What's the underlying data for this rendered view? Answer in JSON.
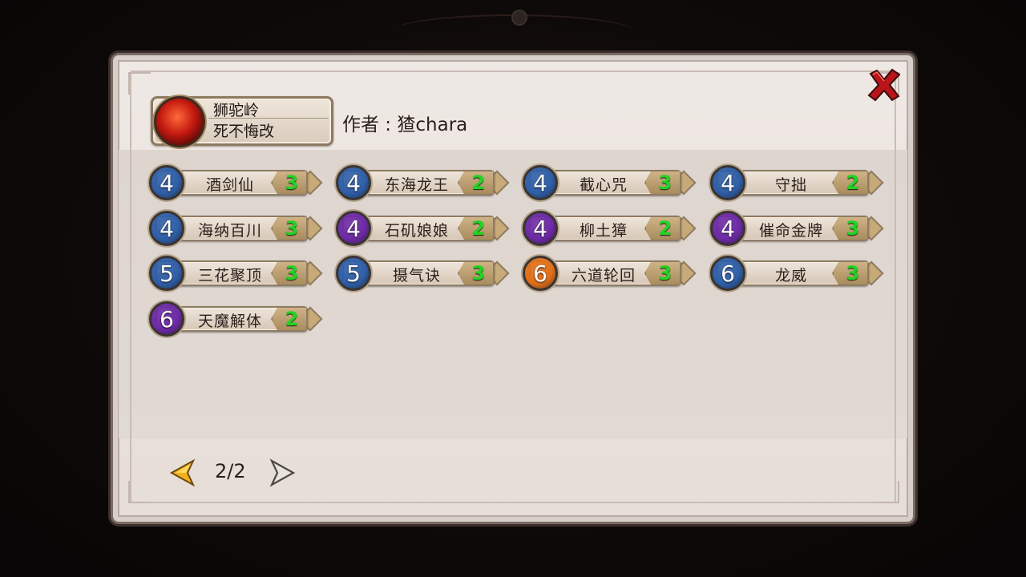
{
  "header": {
    "badge_line1": "狮驼岭",
    "badge_line2": "死不悔改",
    "author": "作者 : 猹chara"
  },
  "colors": {
    "blue": "#2f5fa8",
    "purple": "#6d2aa6",
    "orange": "#e0701a",
    "cost_green": "#22d322"
  },
  "skills": [
    {
      "level": "4",
      "name": "酒剑仙",
      "cost": "3",
      "color": "blue"
    },
    {
      "level": "4",
      "name": "东海龙王",
      "cost": "2",
      "color": "blue"
    },
    {
      "level": "4",
      "name": "截心咒",
      "cost": "3",
      "color": "blue"
    },
    {
      "level": "4",
      "name": "守拙",
      "cost": "2",
      "color": "blue"
    },
    {
      "level": "4",
      "name": "海纳百川",
      "cost": "3",
      "color": "blue"
    },
    {
      "level": "4",
      "name": "石矶娘娘",
      "cost": "2",
      "color": "purple"
    },
    {
      "level": "4",
      "name": "柳土獐",
      "cost": "2",
      "color": "purple"
    },
    {
      "level": "4",
      "name": "催命金牌",
      "cost": "3",
      "color": "purple"
    },
    {
      "level": "5",
      "name": "三花聚顶",
      "cost": "3",
      "color": "blue"
    },
    {
      "level": "5",
      "name": "摄气诀",
      "cost": "3",
      "color": "blue"
    },
    {
      "level": "6",
      "name": "六道轮回",
      "cost": "3",
      "color": "orange"
    },
    {
      "level": "6",
      "name": "龙威",
      "cost": "3",
      "color": "blue"
    },
    {
      "level": "6",
      "name": "天魔解体",
      "cost": "2",
      "color": "purple"
    }
  ],
  "pager": {
    "current": "2/2"
  },
  "icons": {
    "close": "close-x-icon",
    "prev": "arrow-left-icon",
    "next": "arrow-right-icon"
  }
}
